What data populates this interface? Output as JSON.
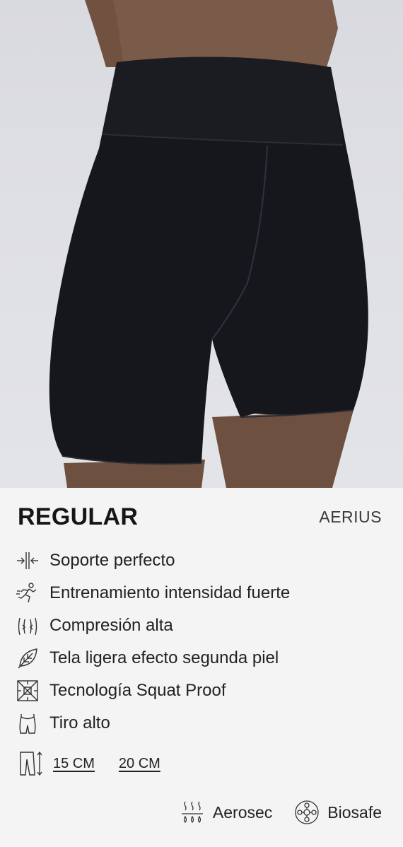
{
  "product": {
    "title": "REGULAR",
    "brand": "AERIUS"
  },
  "features": [
    {
      "icon": "support-arrows-icon",
      "label": "Soporte perfecto"
    },
    {
      "icon": "runner-icon",
      "label": "Entrenamiento intensidad fuerte"
    },
    {
      "icon": "compression-icon",
      "label": "Compresión alta"
    },
    {
      "icon": "leaf-icon",
      "label": "Tela ligera efecto segunda piel"
    },
    {
      "icon": "squat-proof-icon",
      "label": "Tecnología Squat Proof"
    },
    {
      "icon": "high-waist-icon",
      "label": "Tiro alto"
    }
  ],
  "sizes": {
    "icon": "length-icon",
    "options": [
      "15 CM",
      "20 CM"
    ]
  },
  "technologies": [
    {
      "icon": "aerosec-icon",
      "label": "Aerosec"
    },
    {
      "icon": "biosafe-icon",
      "label": "Biosafe"
    }
  ],
  "colors": {
    "background": "#f4f4f4",
    "hero_background": "#dfe0e4",
    "garment": "#16171c",
    "skin": "#7a5a48",
    "text": "#1d1d1f"
  }
}
